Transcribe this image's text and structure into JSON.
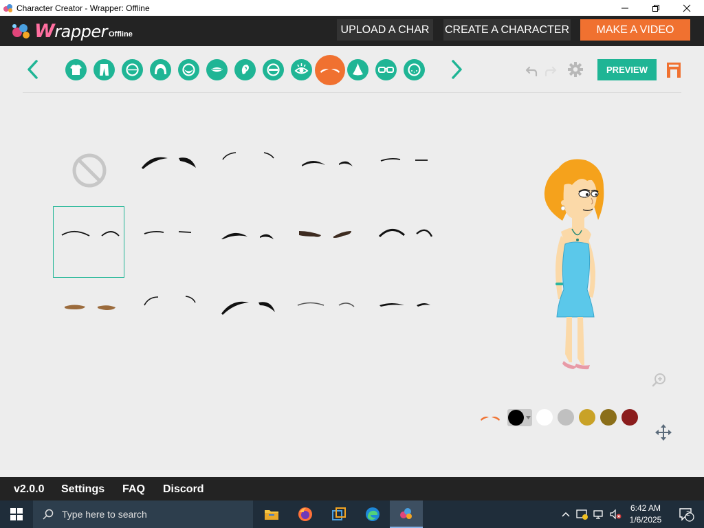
{
  "window": {
    "title": "Character Creator - Wrapper: Offline",
    "controls": [
      "minimize",
      "restore",
      "close"
    ]
  },
  "header": {
    "logo_text": "Wrapper",
    "logo_first": "W",
    "logo_rest": "rapper",
    "logo_sub": "Offline",
    "buttons": {
      "upload": "UPLOAD A CHAR",
      "create": "CREATE A CHARACTER",
      "make_video": "MAKE A VIDEO"
    }
  },
  "toolbar": {
    "categories": [
      {
        "name": "shirt-icon",
        "active": false
      },
      {
        "name": "pants-icon",
        "active": false
      },
      {
        "name": "face-shape-icon",
        "active": false
      },
      {
        "name": "hair-icon",
        "active": false
      },
      {
        "name": "facial-hair-icon",
        "active": false
      },
      {
        "name": "mouth-icon",
        "active": false
      },
      {
        "name": "ear-icon",
        "active": false
      },
      {
        "name": "eyelid-icon",
        "active": false
      },
      {
        "name": "eye-icon",
        "active": false
      },
      {
        "name": "eyebrow-icon",
        "active": true
      },
      {
        "name": "nose-icon",
        "active": false
      },
      {
        "name": "glasses-icon",
        "active": false
      },
      {
        "name": "face-details-icon",
        "active": false
      }
    ],
    "preview_label": "PREVIEW"
  },
  "eyebrows": {
    "selected_index": 5,
    "item_count": 15
  },
  "colors": {
    "accent": "#1fb595",
    "brand_orange": "#f07130",
    "swatches": [
      "#000000",
      "#ffffff",
      "#c0c0c0",
      "#c9a227",
      "#8b6f1a",
      "#8b1d1d"
    ],
    "selected": "#000000"
  },
  "footer": {
    "version": "v2.0.0",
    "settings": "Settings",
    "faq": "FAQ",
    "discord": "Discord"
  },
  "taskbar": {
    "search_placeholder": "Type here to search",
    "time": "6:42 AM",
    "date": "1/6/2025",
    "notification_count": "2"
  }
}
